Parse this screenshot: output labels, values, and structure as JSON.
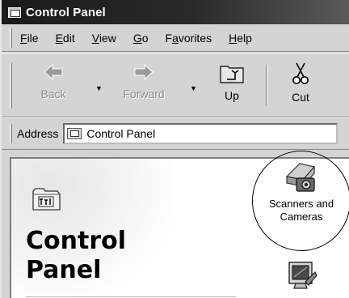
{
  "window": {
    "title": "Control Panel",
    "icon": "control-panel-icon"
  },
  "menu": [
    {
      "pre": "",
      "u": "F",
      "post": "ile"
    },
    {
      "pre": "",
      "u": "E",
      "post": "dit"
    },
    {
      "pre": "",
      "u": "V",
      "post": "iew"
    },
    {
      "pre": "",
      "u": "G",
      "post": "o"
    },
    {
      "pre": "F",
      "u": "a",
      "post": "vorites"
    },
    {
      "pre": "",
      "u": "H",
      "post": "elp"
    }
  ],
  "toolbar": {
    "back": {
      "label": "Back",
      "icon": "back-arrow-icon",
      "enabled": false
    },
    "forward": {
      "label": "Forward",
      "icon": "forward-arrow-icon",
      "enabled": false
    },
    "up": {
      "label": "Up",
      "icon": "up-folder-icon",
      "enabled": true
    },
    "cut": {
      "label": "Cut",
      "icon": "scissors-icon",
      "enabled": true
    }
  },
  "address": {
    "label": "Address",
    "value": "Control Panel",
    "icon": "control-panel-icon"
  },
  "content": {
    "heading_line1": "Control",
    "heading_line2": "Panel",
    "items": [
      {
        "label_line1": "Scanners and",
        "label_line2": "Cameras",
        "icon": "scanner-camera-icon"
      },
      {
        "label_line1": "",
        "label_line2": "",
        "icon": "display-settings-icon"
      }
    ]
  }
}
